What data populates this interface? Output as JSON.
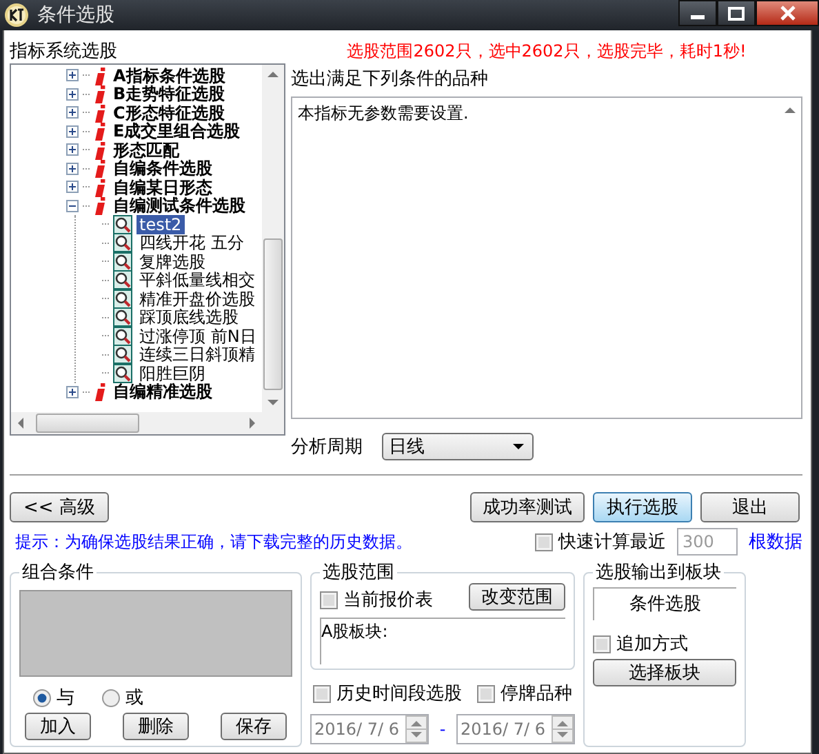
{
  "window": {
    "title": "条件选股"
  },
  "tree": {
    "title": "指标系统选股",
    "items": [
      {
        "kind": "category",
        "label": "A指标条件选股",
        "expanded": false,
        "selected": false
      },
      {
        "kind": "category",
        "label": "B走势特征选股",
        "expanded": false,
        "selected": false
      },
      {
        "kind": "category",
        "label": "C形态特征选股",
        "expanded": false,
        "selected": false
      },
      {
        "kind": "category",
        "label": "E成交里组合选股",
        "expanded": false,
        "selected": false
      },
      {
        "kind": "category",
        "label": "形态匹配",
        "expanded": false,
        "selected": false
      },
      {
        "kind": "category",
        "label": "自编条件选股",
        "expanded": false,
        "selected": false
      },
      {
        "kind": "category",
        "label": "自编某日形态",
        "expanded": false,
        "selected": false
      },
      {
        "kind": "category",
        "label": "自编测试条件选股",
        "expanded": true,
        "selected": false,
        "children": [
          {
            "kind": "formula",
            "label": "test2",
            "selected": true
          },
          {
            "kind": "formula",
            "label": "四线开花 五分",
            "selected": false
          },
          {
            "kind": "formula",
            "label": "复牌选股",
            "selected": false
          },
          {
            "kind": "formula",
            "label": "平斜低量线相交",
            "selected": false
          },
          {
            "kind": "formula",
            "label": "精准开盘价选股",
            "selected": false
          },
          {
            "kind": "formula",
            "label": "踩顶底线选股",
            "selected": false
          },
          {
            "kind": "formula",
            "label": "过涨停顶 前N日",
            "selected": false
          },
          {
            "kind": "formula",
            "label": "连续三日斜顶精",
            "selected": false
          },
          {
            "kind": "formula",
            "label": "阳胜巨阴",
            "selected": false
          }
        ]
      },
      {
        "kind": "category",
        "label": "自编精准选股",
        "expanded": false,
        "selected": false
      }
    ]
  },
  "status_message": "选股范围2602只，选中2602只，选股完毕，耗时1秒!",
  "result": {
    "label": "选出满足下列条件的品种",
    "text": "本指标无参数需要设置."
  },
  "period": {
    "label": "分析周期",
    "value": "日线"
  },
  "advanced_button": "<< 高级",
  "actions": [
    {
      "label": "成功率测试",
      "focused": false
    },
    {
      "label": "执行选股",
      "focused": true
    },
    {
      "label": "退出",
      "focused": false
    }
  ],
  "hint": "提示：为确保选股结果正确，请下载完整的历史数据。",
  "fast_calc": {
    "label": "快速计算最近",
    "checked": false,
    "value": "300",
    "unit": "根数据"
  },
  "combo": {
    "title": "组合条件",
    "radios": [
      {
        "label": "与",
        "selected": true
      },
      {
        "label": "或",
        "selected": false
      }
    ],
    "buttons": [
      "加入",
      "删除",
      "保存"
    ]
  },
  "scope": {
    "title": "选股范围",
    "checkbox": {
      "label": "当前报价表",
      "checked": false
    },
    "button": "改变范围",
    "text": "A股板块:"
  },
  "history": {
    "checkbox": {
      "label": "历史时间段选股",
      "checked": false
    },
    "start": "2016/ 7/ 6",
    "separator": "-",
    "end": "2016/ 7/ 6"
  },
  "suspended": {
    "label": "停牌品种",
    "checked": false
  },
  "output": {
    "title": "选股输出到板块",
    "block": "条件选股",
    "append": {
      "label": "追加方式",
      "checked": false
    },
    "button": "选择板块"
  }
}
